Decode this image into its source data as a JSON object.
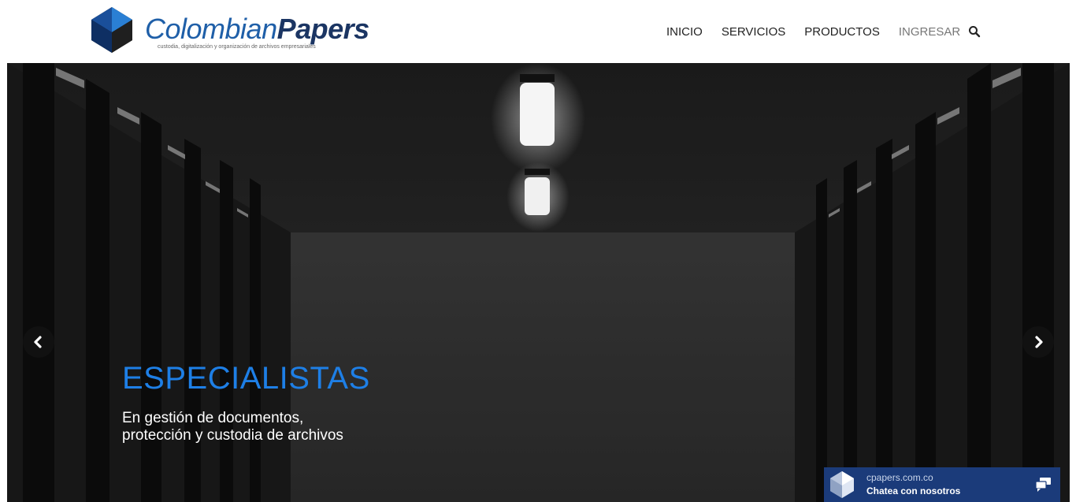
{
  "header": {
    "logo": {
      "word_light": "Colombian",
      "word_bold": "Papers",
      "tagline": "custodia, digitalización y organización de archivos empresariales"
    },
    "nav": [
      {
        "label": "INICIO",
        "active": false
      },
      {
        "label": "SERVICIOS",
        "active": false
      },
      {
        "label": "PRODUCTOS",
        "active": false
      },
      {
        "label": "INGRESAR",
        "active": true
      }
    ],
    "search_icon": "search-icon"
  },
  "hero": {
    "title": "ESPECIALISTAS",
    "subtitle_line1": "En gestión de documentos,",
    "subtitle_line2": "protección y custodia de archivos",
    "prev_icon": "chevron-left-icon",
    "next_icon": "chevron-right-icon"
  },
  "chat": {
    "domain": "cpapers.com.co",
    "label": "Chatea con nosotros",
    "icon": "chat-bubbles-icon"
  },
  "colors": {
    "accent_blue": "#1e7fe6",
    "brand_navy": "#1b3563",
    "chat_bg": "#1b3b7a"
  }
}
